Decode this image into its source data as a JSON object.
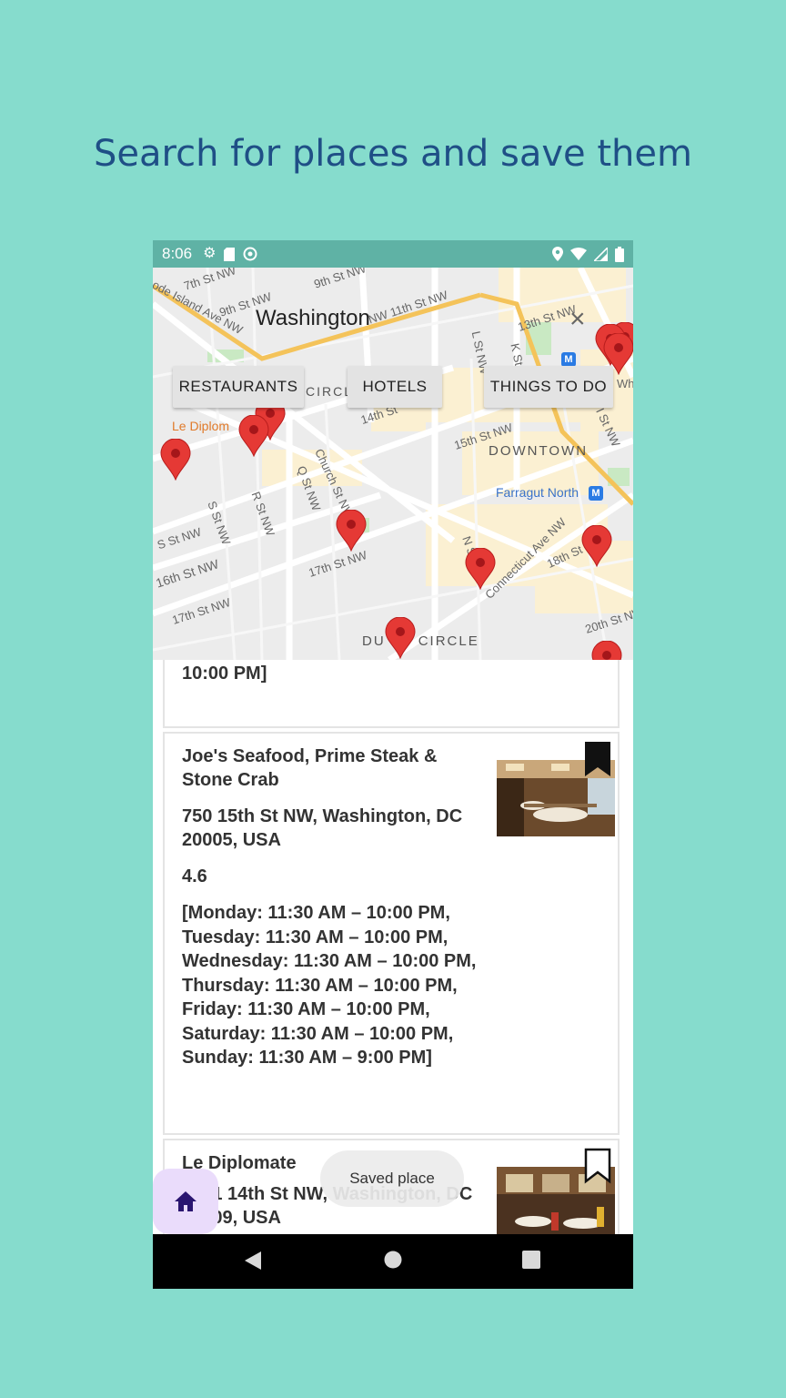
{
  "promo": {
    "title": "Search for places and save them"
  },
  "statusbar": {
    "time": "8:06"
  },
  "map": {
    "labels": {
      "washington": "Washington",
      "downtown": "DOWNTOWN",
      "farragut": "Farragut North",
      "dupont": "DU    NT CIRCLE",
      "le_diplomate": "Le Diplom",
      "circle": "CIRCL",
      "st_7th": "7th St NW",
      "st_9th_a": "9th St NW",
      "st_9th_b": "9th St NW",
      "st_11th": "NW 11th St NW",
      "st_13th": "13th St NW",
      "st_14th": "14th St",
      "st_15th": "15th St NW",
      "st_16th": "16th St NW",
      "st_17th_a": "17th St NW",
      "st_17th_b": "17th St NW",
      "st_18th": "18th St",
      "st_20th": "20th St NW",
      "st_s": "S St NW",
      "st_r": "R St NW",
      "st_q": "Q St NW",
      "st_church": "Church St NW",
      "st_connecticut": "Connecticut Ave NW",
      "st_rhode": "ode Island Ave NW",
      "st_l": "L St NW",
      "st_k": "K St",
      "st_i": "I St NW",
      "st_n": "N St",
      "st_wh": "Wh"
    },
    "metro_badge": "M"
  },
  "filters": {
    "restaurants": "RESTAURANTS",
    "hotels": "HOTELS",
    "things_to_do": "THINGS TO DO"
  },
  "places": [
    {
      "hours_tail": "10:00 PM]"
    },
    {
      "name": "Joe's Seafood, Prime Steak & Stone Crab",
      "address": "750 15th St NW, Washington, DC 20005, USA",
      "rating": "4.6",
      "hours": "[Monday: 11:30 AM – 10:00 PM, Tuesday: 11:30 AM – 10:00 PM, Wednesday: 11:30 AM – 10:00 PM, Thursday: 11:30 AM – 10:00 PM, Friday: 11:30 AM – 10:00 PM, Saturday: 11:30 AM – 10:00 PM, Sunday: 11:30 AM – 9:00 PM]",
      "saved": true
    },
    {
      "name": "Le Diplomate",
      "address": "1601 14th St NW, Washington, DC 20009, USA",
      "saved": false
    }
  ],
  "toast": {
    "text": "Saved place"
  },
  "fab": {
    "icon": "home-icon"
  },
  "colors": {
    "background": "#86dccd",
    "title": "#1f4f86",
    "statusbar": "#5fb2a5",
    "pin": "#e53935",
    "fab": "#eadcfb"
  }
}
